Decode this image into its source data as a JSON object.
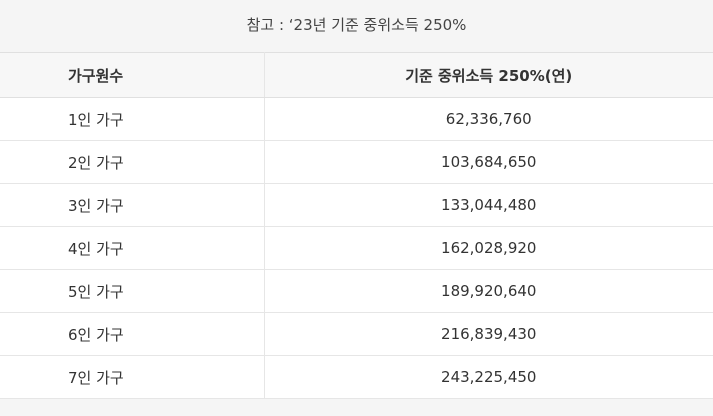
{
  "note": "참고 : ‘23년 기준 중위소득 250%",
  "table": {
    "headers": [
      "가구원수",
      "기준 중위소득 250%(연)"
    ],
    "rows": [
      {
        "household": "1인 가구",
        "income": "62,336,760"
      },
      {
        "household": "2인 가구",
        "income": "103,684,650"
      },
      {
        "household": "3인 가구",
        "income": "133,044,480"
      },
      {
        "household": "4인 가구",
        "income": "162,028,920"
      },
      {
        "household": "5인 가구",
        "income": "189,920,640"
      },
      {
        "household": "6인 가구",
        "income": "216,839,430"
      },
      {
        "household": "7인 가구",
        "income": "243,225,450"
      }
    ]
  }
}
